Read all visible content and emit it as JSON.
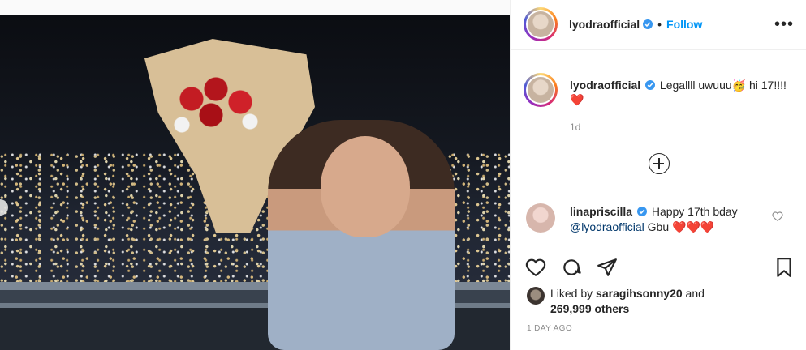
{
  "post": {
    "username": "lyodraofficial",
    "follow_label": "Follow",
    "more_label": "•••",
    "caption_user": "lyodraofficial",
    "caption_text": "Legallll uwuuu🥳 hi 17!!!!❤️",
    "caption_time": "1d",
    "comment_user": "linapriscilla",
    "comment_text_before": "Happy 17th bday",
    "comment_mention": "@lyodraofficial",
    "comment_text_after": "Gbu ❤️❤️❤️",
    "liked_by_prefix": "Liked by",
    "liked_by_user": "saragihsonny20",
    "liked_by_mid": "and",
    "likes_count": "269,999 others",
    "posted_time": "1 DAY AGO"
  },
  "icons": {
    "verified": "verified-badge-icon",
    "like": "heart-icon",
    "comment": "comment-icon",
    "share": "paper-plane-icon",
    "save": "bookmark-icon",
    "load_more": "plus-circle-icon",
    "comment_like": "heart-outline-icon"
  },
  "colors": {
    "accent_blue": "#0095f6",
    "text_primary": "#262626",
    "text_secondary": "#8e8e8e",
    "mention": "#00376b"
  }
}
